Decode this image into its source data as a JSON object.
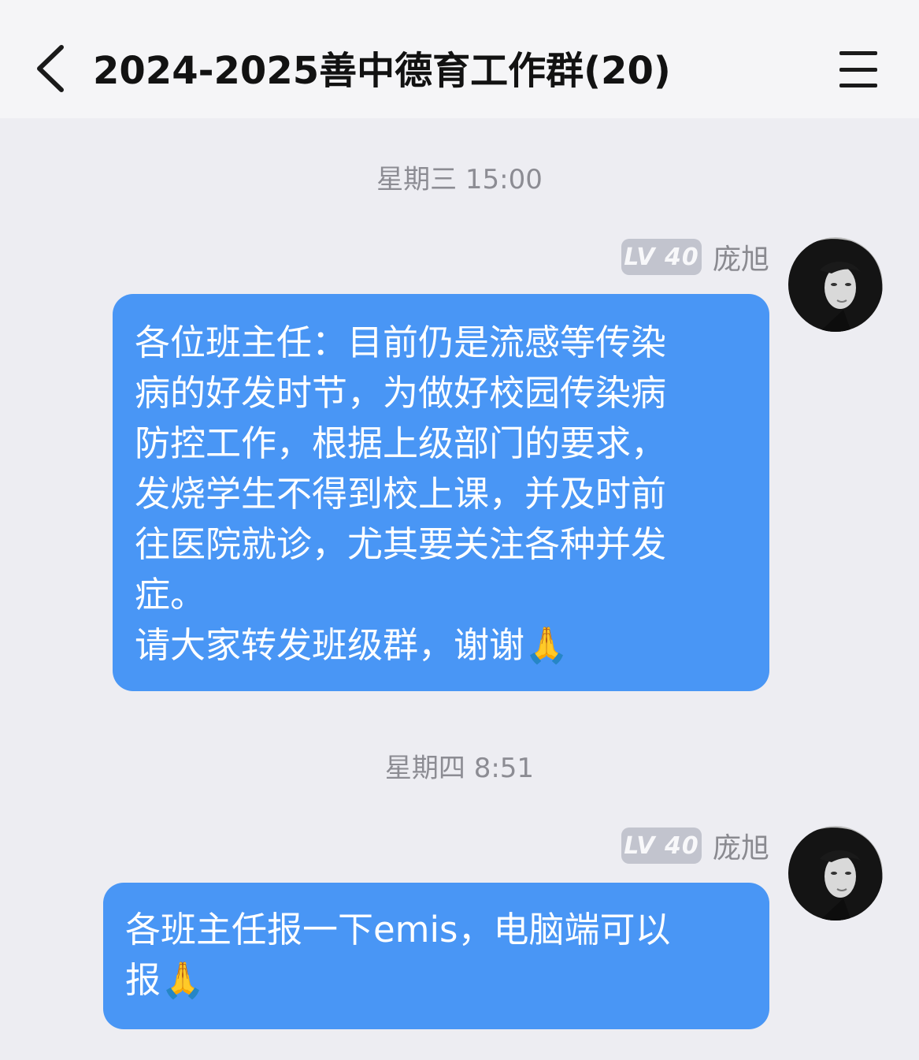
{
  "header": {
    "title": "2024-2025善中德育工作群(20)",
    "back_icon": "chevron-left-icon",
    "menu_icon": "menu-icon"
  },
  "messages": [
    {
      "timestamp": "星期三 15:00",
      "level": "LV 40",
      "sender": "庞旭",
      "text": "各位班主任：目前仍是流感等传染\n病的好发时节，为做好校园传染病\n防控工作，根据上级部门的要求，\n发烧学生不得到校上课，并及时前\n往医院就诊，尤其要关注各种并发\n症。\n请大家转发班级群，谢谢🙏"
    },
    {
      "timestamp": "星期四 8:51",
      "level": "LV 40",
      "sender": "庞旭",
      "text": "各班主任报一下emis，电脑端可以\n报🙏"
    }
  ],
  "colors": {
    "bubble": "#4996f5",
    "background": "#ededf2",
    "header": "#f5f5f7"
  }
}
